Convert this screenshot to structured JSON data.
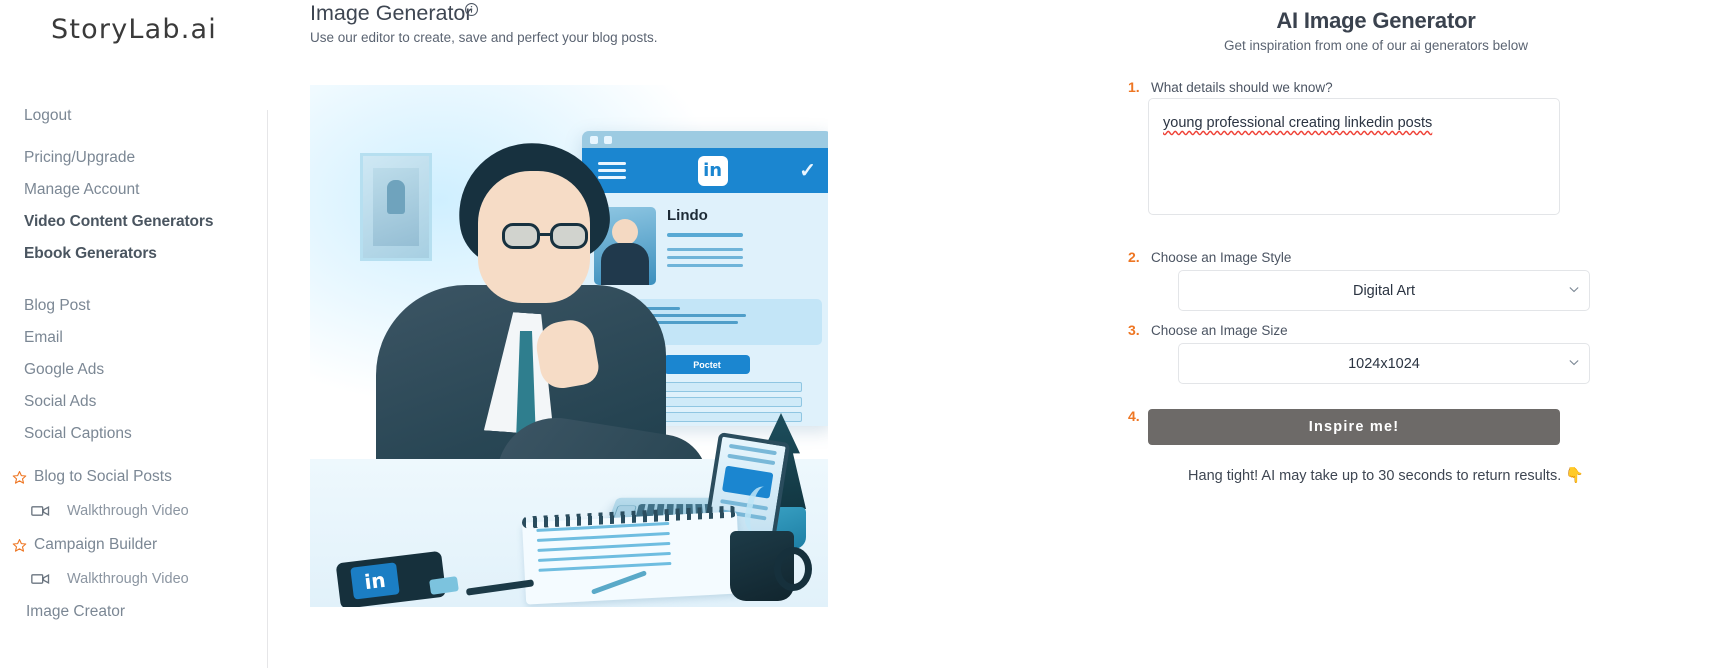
{
  "brand": {
    "name": "StoryLab.ai"
  },
  "sidebar": {
    "items": [
      {
        "label": "Logout",
        "style": "plain",
        "icon": "none"
      },
      {
        "label": "Pricing/Upgrade",
        "style": "plain",
        "icon": "none"
      },
      {
        "label": "Manage Account",
        "style": "plain",
        "icon": "none"
      },
      {
        "label": "Video Content Generators",
        "style": "bold",
        "icon": "none"
      },
      {
        "label": "Ebook Generators",
        "style": "bold",
        "icon": "none"
      },
      {
        "label": "Blog Post",
        "style": "plain",
        "icon": "none"
      },
      {
        "label": "Email",
        "style": "plain",
        "icon": "none"
      },
      {
        "label": "Google Ads",
        "style": "plain",
        "icon": "none"
      },
      {
        "label": "Social Ads",
        "style": "plain",
        "icon": "none"
      },
      {
        "label": "Social Captions",
        "style": "plain",
        "icon": "none"
      },
      {
        "label": "Blog to Social Posts",
        "style": "star",
        "icon": "star-icon"
      },
      {
        "label": "Walkthrough Video",
        "style": "video",
        "icon": "video-camera-icon"
      },
      {
        "label": "Campaign Builder",
        "style": "star",
        "icon": "star-icon"
      },
      {
        "label": "Walkthrough Video",
        "style": "video",
        "icon": "video-camera-icon"
      },
      {
        "label": "Image Creator",
        "style": "plain",
        "icon": "none"
      }
    ]
  },
  "center": {
    "title": "Image Generator",
    "info_icon": "info-circle-icon",
    "subtitle": "Use our editor to create, save and perfect your blog posts.",
    "illustration": {
      "alt": "Digital art of a young professional in glasses writing notes at a desk with a LinkedIn profile on screen",
      "screen_profile_name": "Lindo",
      "screen_button_label": "Poctet",
      "screen_logo": "in",
      "phone_logo": "in",
      "card_logo": "in"
    }
  },
  "right": {
    "title": "AI Image Generator",
    "subtitle": "Get inspiration from one of our ai generators below",
    "steps": [
      {
        "num": "1.",
        "label": "What details should we know?"
      },
      {
        "num": "2.",
        "label": "Choose an Image Style"
      },
      {
        "num": "3.",
        "label": "Choose an Image Size"
      },
      {
        "num": "4.",
        "label": ""
      }
    ],
    "prompt": {
      "value": "young professional creating linkedin posts",
      "placeholder": "",
      "spellcheck_words": [
        "young",
        "creating",
        "linkedin",
        "posts"
      ]
    },
    "image_style": {
      "value": "Digital Art",
      "chevron": "chevron-down-icon"
    },
    "image_size": {
      "value": "1024x1024",
      "chevron": "chevron-down-icon"
    },
    "inspire_button": {
      "label": "Inspire me!"
    },
    "hang_tight": {
      "text": "Hang tight! AI may take up to 30 seconds to return results.",
      "emoji": "👇"
    }
  },
  "colors": {
    "accent_orange": "#ee7623",
    "button_gray": "#6d6a68",
    "text_gray": "#7b8794",
    "heading": "#3a424e",
    "border": "#e3e5e8",
    "linkedin_blue": "#1b86d0"
  }
}
